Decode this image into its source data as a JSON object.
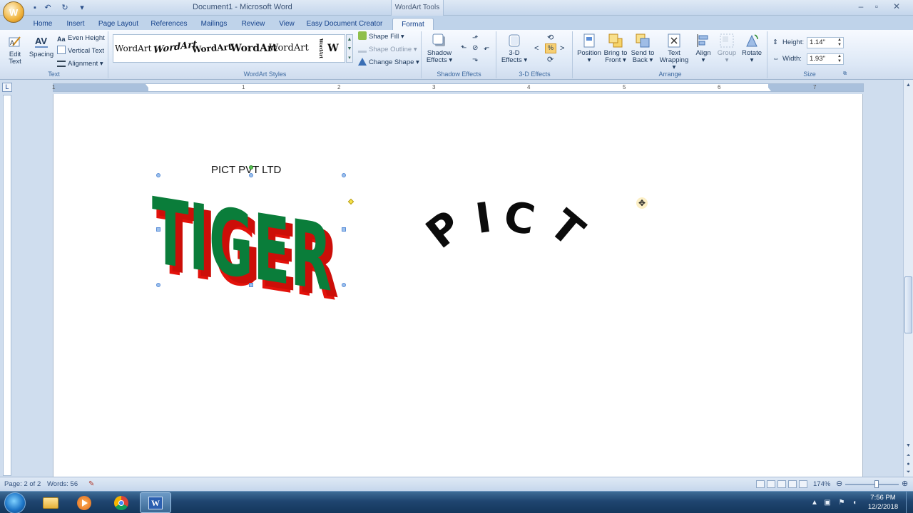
{
  "window": {
    "title": "Document1 - Microsoft Word",
    "contextual_tab_group": "WordArt Tools",
    "office_button_glyph": "W"
  },
  "quick_access": {
    "save_icon": "save-icon",
    "undo_icon": "undo-icon",
    "redo_icon": "redo-icon"
  },
  "tabs": [
    "Home",
    "Insert",
    "Page Layout",
    "References",
    "Mailings",
    "Review",
    "View",
    "Easy Document Creator",
    "Format"
  ],
  "ribbon": {
    "text_group": {
      "label": "Text",
      "edit_text": "Edit\nText",
      "spacing": "Spacing",
      "even_height": "Even Height",
      "vertical_text": "Vertical Text",
      "alignment": "Alignment"
    },
    "wordart_styles": {
      "label": "WordArt Styles",
      "samples": [
        "WordArt",
        "WordArt",
        "WordArt",
        "WordArt",
        "WordArt",
        "WordArt",
        "W"
      ],
      "shape_fill": "Shape Fill",
      "shape_outline": "Shape Outline",
      "change_shape": "Change Shape"
    },
    "shadow_effects": {
      "label": "Shadow Effects",
      "button": "Shadow\nEffects"
    },
    "threed_effects": {
      "label": "3-D Effects",
      "button": "3-D\nEffects"
    },
    "arrange": {
      "label": "Arrange",
      "position": "Position",
      "bring_to_front": "Bring to\nFront",
      "send_to_back": "Send to\nBack",
      "text_wrapping": "Text\nWrapping",
      "align": "Align",
      "group": "Group",
      "rotate": "Rotate"
    },
    "size": {
      "label": "Size",
      "height_label": "Height:",
      "height_value": "1.14\"",
      "width_label": "Width:",
      "width_value": "1.93\""
    }
  },
  "ruler": {
    "numbers": [
      "1",
      "1",
      "2",
      "3",
      "4",
      "5",
      "6",
      "7"
    ]
  },
  "document": {
    "caption_text": "PICT PVT LTD",
    "wordart_3d": "TIGER",
    "wordart_arch_letters": [
      "P",
      "I",
      "C",
      "T"
    ],
    "colors": {
      "tiger_face": "#0a7d3a",
      "tiger_side": "#e3120b",
      "arch_text": "#0b0b0b",
      "selection_handle": "#5b8ed8"
    }
  },
  "statusbar": {
    "page": "Page: 2 of 2",
    "words": "Words: 56",
    "zoom": "174%"
  },
  "taskbar": {
    "time": "7:56 PM",
    "date": "12/2/2018"
  }
}
